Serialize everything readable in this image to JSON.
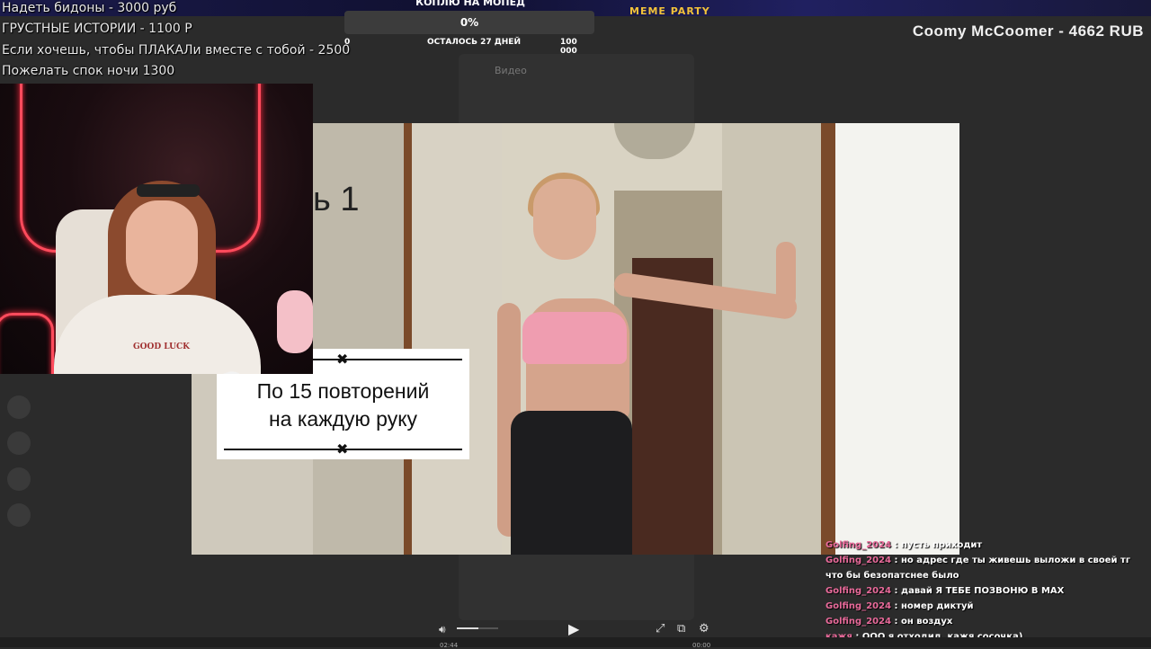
{
  "donation_menu": [
    "Надеть бидоны - 3000 руб",
    "ГРУСТНЫЕ ИСТОРИИ - 1100 Р",
    "Если хочешь, чтобы ПЛАКАЛи вместе с тобой - 2500",
    "Пожелать спок ночи 1300"
  ],
  "goal": {
    "title": "КОПЛЮ НА МОПЕД",
    "percent": "0%",
    "progress": 0,
    "min": "0",
    "remaining": "ОСТАЛОСЬ 27 ДНЕЙ",
    "max": "100 000"
  },
  "meme_banner": "MEME PARTY",
  "top_donor": "Coomy McCoomer - 4662 RUB",
  "background_window": {
    "title": "Видео"
  },
  "webcam": {
    "shirt_text": "GOOD LUCK"
  },
  "video": {
    "title_fragment": "ь 1",
    "caption_line1": "По 15 повторений",
    "caption_line2": "на каждую руку"
  },
  "chat": [
    {
      "user": "Golfing_2024",
      "text": "пусть приходит"
    },
    {
      "user": "Golfing_2024",
      "text": "но адрес где ты живешь выложи в своей тг что бы безопатснее было"
    },
    {
      "user": "Golfing_2024",
      "text": "давай Я ТЕБЕ ПОЗВОНЮ В МАХ"
    },
    {
      "user": "Golfing_2024",
      "text": "номер диктуй"
    },
    {
      "user": "Golfing_2024",
      "text": "он воздух"
    },
    {
      "user": "кажя",
      "text": "ООО я отходил. кажя сосочка)"
    }
  ],
  "player": {
    "time_current": "02:44",
    "time_total": "00:00",
    "volume_level": 0.5
  },
  "colors": {
    "chat_user": "#e86a9a",
    "neon": "#ff4b5c",
    "goal_bar": "#3c3c3c"
  },
  "icons": [
    "volume-icon",
    "play-icon",
    "fullscreen-icon",
    "pip-icon",
    "settings-icon",
    "close-x-icon"
  ]
}
